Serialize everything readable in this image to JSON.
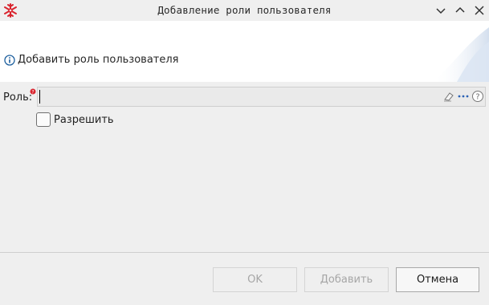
{
  "window": {
    "title": "Добавление роли пользователя"
  },
  "banner": {
    "message": "Добавить роль пользователя"
  },
  "form": {
    "role_label": "Роль:",
    "role_value": "",
    "allow_label": "Разрешить",
    "allow_checked": false
  },
  "buttons": {
    "ok_label": "OK",
    "add_label": "Добавить",
    "cancel_label": "Отмена"
  },
  "icons": {
    "app": "snowflake-icon",
    "info": "info-icon",
    "required": "required-marker-icon",
    "clear": "eraser-icon",
    "browse": "ellipsis-icon",
    "help": "help-icon",
    "minimize": "chevron-down-icon",
    "maximize": "chevron-up-icon",
    "close": "close-icon"
  },
  "colors": {
    "app_icon": "#d9232d",
    "info_icon": "#1d5f9e",
    "required": "#d9232d",
    "browse": "#2b62b5"
  }
}
